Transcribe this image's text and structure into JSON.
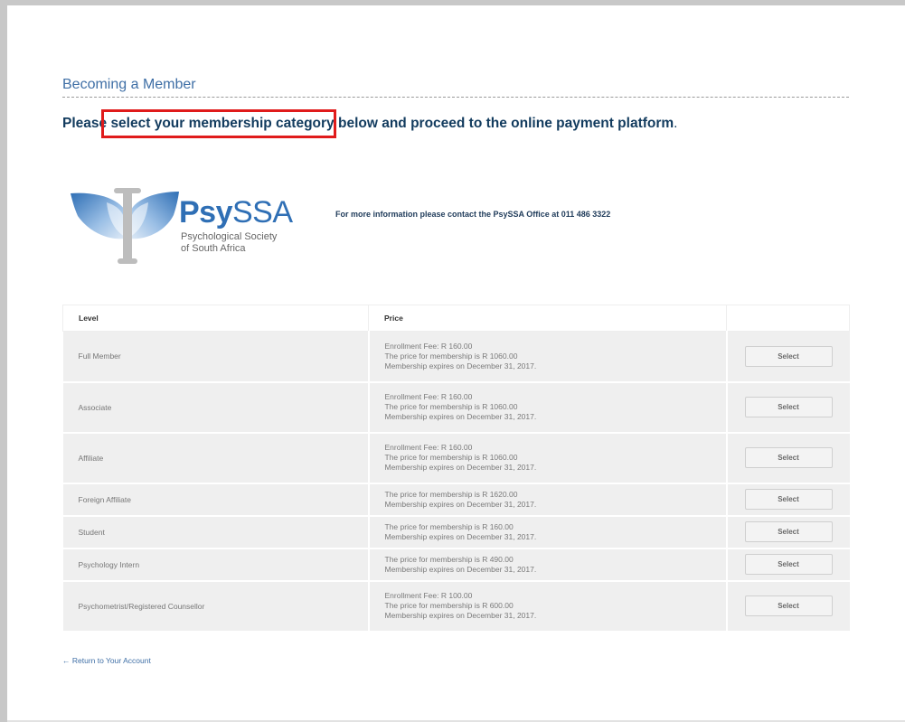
{
  "page": {
    "title": "Becoming a Member",
    "intro_prefix": "Please ",
    "intro_highlight": "select your membership category",
    "intro_suffix": " below and proceed to the online payment platform",
    "intro_end": "."
  },
  "logo": {
    "brand_bold": "Psy",
    "brand_light": "SSA",
    "tagline": "Psychological Society\nof South Africa",
    "colors": {
      "blue": "#2f6fb5",
      "grey": "#bdbdbd"
    }
  },
  "contact_text": "For more information please contact the PsySSA Office at 011 486 3322",
  "table": {
    "headers": {
      "level": "Level",
      "price": "Price"
    },
    "select_label": "Select",
    "rows": [
      {
        "level": "Full Member",
        "lines": [
          "Enrollment Fee: R 160.00",
          "The price for membership is R 1060.00",
          "Membership expires on December 31, 2017."
        ]
      },
      {
        "level": "Associate",
        "lines": [
          "Enrollment Fee: R 160.00",
          "The price for membership is R 1060.00",
          "Membership expires on December 31, 2017."
        ]
      },
      {
        "level": "Affiliate",
        "lines": [
          "Enrollment Fee: R 160.00",
          "The price for membership is R 1060.00",
          "Membership expires on December 31, 2017."
        ]
      },
      {
        "level": "Foreign Affiliate",
        "lines": [
          "The price for membership is R 1620.00",
          "Membership expires on December 31, 2017."
        ]
      },
      {
        "level": "Student",
        "lines": [
          "The price for membership is R 160.00",
          "Membership expires on December 31, 2017."
        ]
      },
      {
        "level": "Psychology Intern",
        "lines": [
          "The price for membership is R 490.00",
          "Membership expires on December 31, 2017."
        ]
      },
      {
        "level": "Psychometrist/Registered Counsellor",
        "lines": [
          "Enrollment Fee: R 100.00",
          "The price for membership is R 600.00",
          "Membership expires on December 31, 2017."
        ]
      }
    ]
  },
  "return_link": "← Return to Your Account",
  "colors": {
    "title_blue": "#3f6fa6",
    "intro_navy": "#123b5e",
    "highlight_red": "#e01b1b",
    "row_bg": "#efefef"
  }
}
